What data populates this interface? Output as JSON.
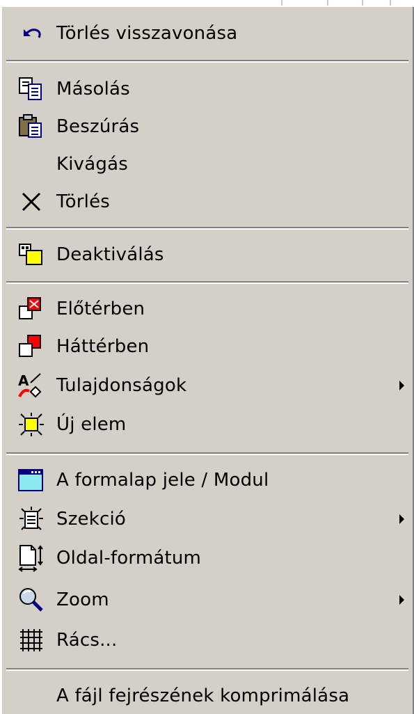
{
  "menu": {
    "items": [
      {
        "id": "undo",
        "label": "Törlés visszavonása",
        "icon": "undo-arrow-icon"
      },
      {
        "id": "copy",
        "label": "Másolás",
        "icon": "copy-icon"
      },
      {
        "id": "paste",
        "label": "Beszúrás",
        "icon": "paste-clipboard-icon"
      },
      {
        "id": "cut",
        "label": "Kivágás",
        "icon": ""
      },
      {
        "id": "delete",
        "label": "Törlés",
        "icon": "delete-x-icon"
      },
      {
        "id": "deactivate",
        "label": "Deaktiválás",
        "icon": "deactivate-icon"
      },
      {
        "id": "bring-front",
        "label": "Előtérben",
        "icon": "bring-to-front-icon"
      },
      {
        "id": "send-back",
        "label": "Háttérben",
        "icon": "send-to-back-icon"
      },
      {
        "id": "properties",
        "label": "Tulajdonságok",
        "icon": "properties-icon",
        "submenu": true
      },
      {
        "id": "new-element",
        "label": "Új elem",
        "icon": "new-element-icon"
      },
      {
        "id": "form-symbol",
        "label": "A formalap jele / Modul",
        "icon": "form-window-icon"
      },
      {
        "id": "section",
        "label": "Szekció",
        "icon": "section-icon",
        "submenu": true
      },
      {
        "id": "page-format",
        "label": "Oldal-formátum",
        "icon": "page-format-icon"
      },
      {
        "id": "zoom",
        "label": "Zoom",
        "icon": "zoom-magnifier-icon",
        "submenu": true
      },
      {
        "id": "grid",
        "label": "Rács...",
        "icon": "grid-icon"
      },
      {
        "id": "compress-header",
        "label": "A fájl fejrészének komprimálása",
        "icon": ""
      }
    ]
  },
  "colors": {
    "menu_bg": "#d4d0c8",
    "separator_dark": "#808080",
    "separator_light": "#ffffff",
    "icon_yellow": "#ffff00",
    "icon_red": "#ff0000",
    "icon_cyan": "#8ee8f0",
    "icon_navy": "#000080"
  }
}
